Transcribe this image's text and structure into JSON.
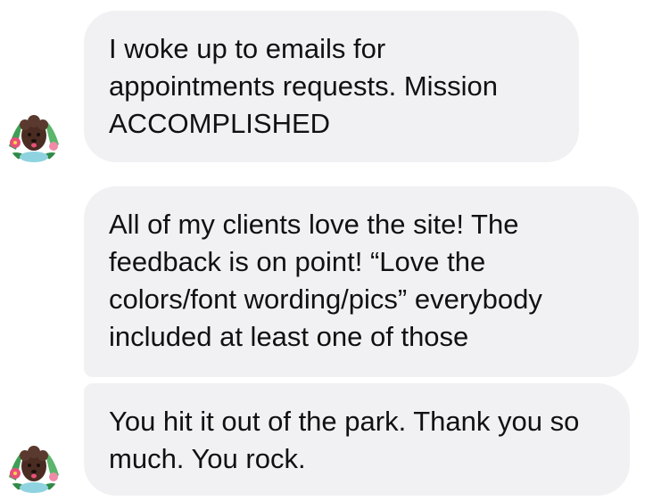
{
  "messages": [
    {
      "text": "I woke up to emails for appointments requests. Mission ACCOMPLISHED"
    },
    {
      "text": "All of my clients love the site! The feedback is on point! “Love the colors/font wording/pics” everybody included at least one of those"
    },
    {
      "text": "You hit it out of the park. Thank you so much. You rock."
    }
  ],
  "colors": {
    "bubble_bg": "#f1f1f4",
    "text": "#111111",
    "avatar_leaf": "#3f9e55",
    "avatar_flower": "#e8507a",
    "avatar_dog": "#4a2c22"
  },
  "avatar": {
    "icon": "poodle-avatar-icon"
  }
}
